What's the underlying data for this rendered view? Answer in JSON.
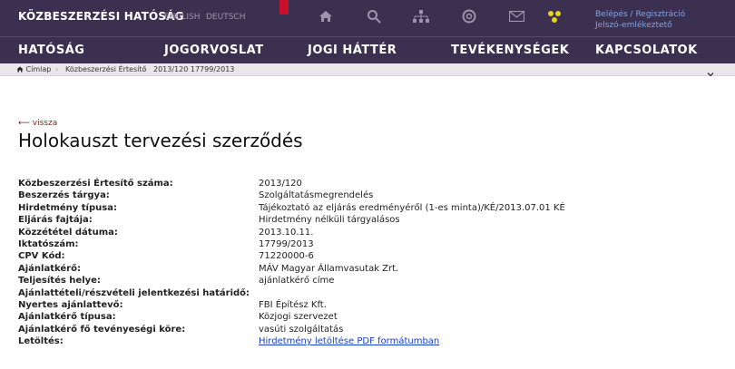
{
  "header": {
    "logo": "KÖZBESZERZÉSI HATÓSÁG",
    "languages": [
      "ENGLISH",
      "DEUTSCH"
    ],
    "login": "Belépés / Regisztráció",
    "password_reminder": "Jelszó-emlékeztető",
    "icons": [
      "home-icon",
      "search-icon",
      "sitemap-icon",
      "help-icon",
      "mail-icon",
      "accessibility-icon"
    ],
    "colors": {
      "bar": "#3b3050",
      "accent": "#c8102e",
      "link": "#1a3ec9"
    }
  },
  "nav": {
    "items": [
      "HATÓSÁG",
      "JOGORVOSLAT",
      "JOGI HÁTTÉR",
      "TEVÉKENYSÉGEK",
      "KAPCSOLATOK"
    ]
  },
  "breadcrumb": {
    "items": [
      "Címlap",
      "Közbeszerzési Értesítő",
      "2013/120 17799/2013"
    ]
  },
  "main": {
    "back": "⟵ vissza",
    "title": "Holokauszt tervezési szerződés",
    "fields": [
      {
        "label": "Közbeszerzési Értesítő száma:",
        "value": "2013/120"
      },
      {
        "label": "Beszerzés tárgya:",
        "value": "Szolgáltatásmegrendelés"
      },
      {
        "label": "Hirdetmény típusa:",
        "value": "Tájékoztató az eljárás eredményéről (1-es minta)/KÉ/2013.07.01 KÉ"
      },
      {
        "label": "Eljárás fajtája:",
        "value": "Hirdetmény nélküli tárgyalásos"
      },
      {
        "label": "Közzététel dátuma:",
        "value": "2013.10.11."
      },
      {
        "label": "Iktatószám:",
        "value": "17799/2013"
      },
      {
        "label": "CPV Kód:",
        "value": "71220000-6"
      },
      {
        "label": "Ajánlatkérő:",
        "value": "MÁV Magyar Államvasutak Zrt."
      },
      {
        "label": "Teljesítés helye:",
        "value": "ajánlatkérő címe"
      },
      {
        "label": "Ajánlattételi/részvételi jelentkezési határidő:",
        "value": ""
      },
      {
        "label": "Nyertes ajánlattevő:",
        "value": "FBI Építész Kft."
      },
      {
        "label": "Ajánlatkérő típusa:",
        "value": "Közjogi szervezet"
      },
      {
        "label": "Ajánlatkérő fő tevényeségi köre:",
        "value": "vasúti szolgáltatás"
      },
      {
        "label": "Letöltés:",
        "value": "Hirdetmény letöltése PDF formátumban"
      }
    ]
  }
}
